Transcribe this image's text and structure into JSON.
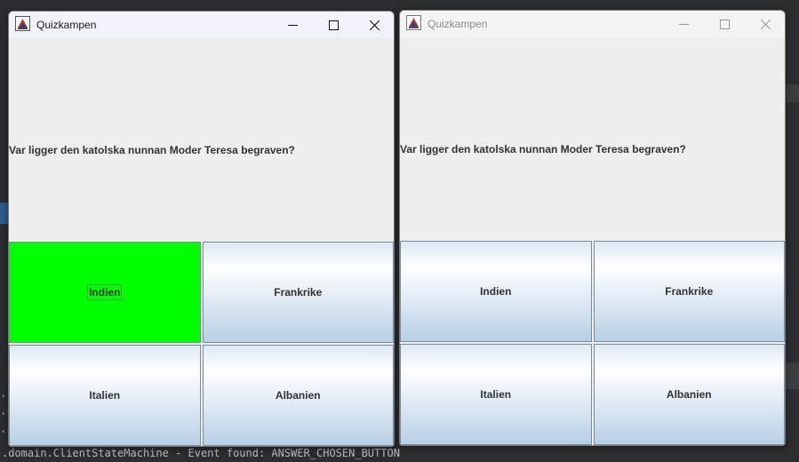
{
  "colors": {
    "correct_answer": "#00ff00",
    "ide_background": "#2b2d30"
  },
  "background_console": {
    "line": ".domain.ClientStateMachine - Event found: ANSWER_CHOSEN_BUTTON",
    "dots": [
      "·",
      "·",
      "·"
    ]
  },
  "windows": [
    {
      "title": "Quizkampen",
      "active": true,
      "question": "Var ligger den katolska nunnan Moder Teresa begraven?",
      "answers": [
        {
          "label": "Indien",
          "state": "correct"
        },
        {
          "label": "Frankrike",
          "state": "default"
        },
        {
          "label": "Italien",
          "state": "default"
        },
        {
          "label": "Albanien",
          "state": "default"
        }
      ]
    },
    {
      "title": "Quizkampen",
      "active": false,
      "question": "Var ligger den katolska nunnan Moder Teresa begraven?",
      "answers": [
        {
          "label": "Indien",
          "state": "default"
        },
        {
          "label": "Frankrike",
          "state": "default"
        },
        {
          "label": "Italien",
          "state": "default"
        },
        {
          "label": "Albanien",
          "state": "default"
        }
      ]
    }
  ],
  "icons": {
    "app": "java-app-icon",
    "minimize": "minimize-icon",
    "maximize": "maximize-icon",
    "close": "close-icon"
  }
}
